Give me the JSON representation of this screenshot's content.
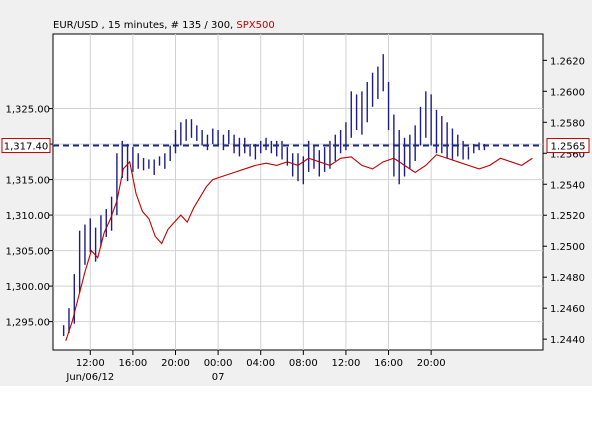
{
  "chart_data": {
    "type": "line",
    "title": {
      "main": "EUR/USD , 15 minutes, # 135 / 300, ",
      "overlay": "SPX500"
    },
    "left_axis": {
      "ylim": [
        1291,
        1335.5
      ],
      "ticks": [
        "1,295.00",
        "1,300.00",
        "1,305.00",
        "1,310.00",
        "1,315.00",
        "1,320.00",
        "1,325.00"
      ],
      "tick_values": [
        1295,
        1300,
        1305,
        1310,
        1315,
        1320,
        1325
      ],
      "current_label": "1,317.40",
      "current_value": 1317.4
    },
    "right_axis": {
      "ylim": [
        1.2433,
        1.2637
      ],
      "ticks": [
        "1.2440",
        "1.2460",
        "1.2480",
        "1.2500",
        "1.2520",
        "1.2540",
        "1.2560",
        "1.2580",
        "1.2600",
        "1.2620"
      ],
      "tick_values": [
        1.244,
        1.246,
        1.248,
        1.25,
        1.252,
        1.254,
        1.256,
        1.258,
        1.26,
        1.262
      ],
      "current_label": "1.2565",
      "current_value": 1.2565
    },
    "x_axis": {
      "xlim": [
        8.5,
        31.5
      ],
      "ticks": [
        "12:00",
        "16:00",
        "20:00",
        "00:00",
        "04:00",
        "08:00",
        "12:00",
        "16:00",
        "20:00"
      ],
      "tick_hours": [
        12,
        16,
        20,
        24,
        28,
        32,
        36,
        40,
        44
      ],
      "date_labels": [
        {
          "text": "Jun/06/12",
          "hour": 12
        },
        {
          "text": "07",
          "hour": 24
        }
      ]
    },
    "grid": true,
    "colors": {
      "bars": "#1c1c8c",
      "overlay_line": "#c00000",
      "current_line": "#1a2b7a",
      "plot_bg": "#ffffff",
      "frame_bg": "#f0f0f0"
    },
    "series": [
      {
        "name": "SPX500",
        "axis": "left",
        "points": [
          [
            9.1,
            1292.3
          ],
          [
            9.4,
            1295.0
          ],
          [
            9.7,
            1298.5
          ],
          [
            10.0,
            1302.0
          ],
          [
            10.3,
            1305.0
          ],
          [
            10.6,
            1304.0
          ],
          [
            10.9,
            1307.5
          ],
          [
            11.2,
            1309.5
          ],
          [
            11.5,
            1312.0
          ],
          [
            11.8,
            1316.5
          ],
          [
            12.1,
            1317.5
          ],
          [
            12.4,
            1313.0
          ],
          [
            12.7,
            1310.5
          ],
          [
            13.0,
            1309.5
          ],
          [
            13.3,
            1307.0
          ],
          [
            13.6,
            1306.0
          ],
          [
            13.9,
            1308.0
          ],
          [
            14.2,
            1309.0
          ],
          [
            14.5,
            1310.0
          ],
          [
            14.8,
            1309.0
          ],
          [
            15.1,
            1311.0
          ],
          [
            15.4,
            1312.5
          ],
          [
            15.7,
            1314.0
          ],
          [
            16.0,
            1315.0
          ],
          [
            16.5,
            1315.5
          ],
          [
            17.0,
            1316.0
          ],
          [
            17.5,
            1316.5
          ],
          [
            18.0,
            1317.0
          ],
          [
            18.5,
            1317.3
          ],
          [
            19.0,
            1317.0
          ],
          [
            19.5,
            1317.5
          ],
          [
            20.0,
            1317.0
          ],
          [
            20.5,
            1318.0
          ],
          [
            21.0,
            1317.5
          ],
          [
            21.5,
            1317.0
          ],
          [
            22.0,
            1318.0
          ],
          [
            22.5,
            1318.2
          ],
          [
            23.0,
            1317.0
          ],
          [
            23.5,
            1316.5
          ],
          [
            24.0,
            1317.5
          ],
          [
            24.5,
            1318.0
          ],
          [
            25.0,
            1317.0
          ],
          [
            25.5,
            1316.0
          ],
          [
            26.0,
            1317.0
          ],
          [
            26.5,
            1318.5
          ],
          [
            27.0,
            1318.0
          ],
          [
            27.5,
            1317.5
          ],
          [
            28.0,
            1317.0
          ],
          [
            28.5,
            1316.5
          ],
          [
            29.0,
            1317.0
          ],
          [
            29.5,
            1318.0
          ],
          [
            30.0,
            1317.5
          ],
          [
            30.5,
            1317.0
          ],
          [
            31.0,
            1318.0
          ]
        ]
      }
    ],
    "eurusd_bars": {
      "axis": "right",
      "bars": [
        [
          9.0,
          1.2442,
          1.2449
        ],
        [
          9.25,
          1.2444,
          1.246
        ],
        [
          9.5,
          1.245,
          1.2482
        ],
        [
          9.75,
          1.247,
          1.251
        ],
        [
          10.0,
          1.2488,
          1.2514
        ],
        [
          10.25,
          1.2496,
          1.2518
        ],
        [
          10.5,
          1.249,
          1.2512
        ],
        [
          10.75,
          1.25,
          1.252
        ],
        [
          11.0,
          1.2506,
          1.2524
        ],
        [
          11.25,
          1.251,
          1.2532
        ],
        [
          11.5,
          1.252,
          1.256
        ],
        [
          11.75,
          1.2544,
          1.2568
        ],
        [
          12.0,
          1.2542,
          1.2566
        ],
        [
          12.25,
          1.2548,
          1.2564
        ],
        [
          12.5,
          1.255,
          1.256
        ],
        [
          12.75,
          1.2549,
          1.2557
        ],
        [
          13.0,
          1.255,
          1.2556
        ],
        [
          13.25,
          1.2546,
          1.2556
        ],
        [
          13.5,
          1.2552,
          1.2558
        ],
        [
          13.75,
          1.255,
          1.256
        ],
        [
          14.0,
          1.2555,
          1.2565
        ],
        [
          14.25,
          1.256,
          1.2575
        ],
        [
          14.5,
          1.2565,
          1.258
        ],
        [
          14.75,
          1.2568,
          1.2582
        ],
        [
          15.0,
          1.257,
          1.2582
        ],
        [
          15.25,
          1.2568,
          1.2578
        ],
        [
          15.5,
          1.2565,
          1.2575
        ],
        [
          15.75,
          1.2562,
          1.2572
        ],
        [
          16.0,
          1.2566,
          1.2576
        ],
        [
          16.25,
          1.2565,
          1.2575
        ],
        [
          16.5,
          1.2562,
          1.2572
        ],
        [
          16.75,
          1.2566,
          1.2575
        ],
        [
          17.0,
          1.256,
          1.2572
        ],
        [
          17.25,
          1.2558,
          1.257
        ],
        [
          17.5,
          1.256,
          1.257
        ],
        [
          17.75,
          1.2558,
          1.2566
        ],
        [
          18.0,
          1.2556,
          1.2566
        ],
        [
          18.25,
          1.256,
          1.2568
        ],
        [
          18.5,
          1.2562,
          1.257
        ],
        [
          18.75,
          1.256,
          1.2568
        ],
        [
          19.0,
          1.2558,
          1.2568
        ],
        [
          19.25,
          1.2556,
          1.2568
        ],
        [
          19.5,
          1.2552,
          1.2564
        ],
        [
          19.75,
          1.2545,
          1.256
        ],
        [
          20.0,
          1.2542,
          1.256
        ],
        [
          20.25,
          1.254,
          1.2558
        ],
        [
          20.5,
          1.2548,
          1.2568
        ],
        [
          20.75,
          1.255,
          1.2565
        ],
        [
          21.0,
          1.2545,
          1.2562
        ],
        [
          21.25,
          1.2548,
          1.2564
        ],
        [
          21.5,
          1.255,
          1.2568
        ],
        [
          21.75,
          1.2555,
          1.2572
        ],
        [
          22.0,
          1.256,
          1.2575
        ],
        [
          22.25,
          1.2562,
          1.258
        ],
        [
          22.5,
          1.257,
          1.26
        ],
        [
          22.75,
          1.2575,
          1.2598
        ],
        [
          23.0,
          1.2572,
          1.26
        ],
        [
          23.25,
          1.258,
          1.2606
        ],
        [
          23.5,
          1.259,
          1.2612
        ],
        [
          23.75,
          1.2595,
          1.2616
        ],
        [
          24.0,
          1.26,
          1.2624
        ],
        [
          24.25,
          1.2575,
          1.2606
        ],
        [
          24.5,
          1.2545,
          1.2585
        ],
        [
          24.75,
          1.254,
          1.2575
        ],
        [
          25.0,
          1.2545,
          1.257
        ],
        [
          25.25,
          1.255,
          1.2572
        ],
        [
          25.5,
          1.2555,
          1.2578
        ],
        [
          25.75,
          1.2565,
          1.259
        ],
        [
          26.0,
          1.257,
          1.26
        ],
        [
          26.25,
          1.2565,
          1.2598
        ],
        [
          26.5,
          1.256,
          1.2588
        ],
        [
          26.75,
          1.256,
          1.2584
        ],
        [
          27.0,
          1.2557,
          1.258
        ],
        [
          27.25,
          1.2556,
          1.2576
        ],
        [
          27.5,
          1.2558,
          1.2572
        ],
        [
          27.75,
          1.2556,
          1.2568
        ],
        [
          28.0,
          1.2556,
          1.2564
        ],
        [
          28.25,
          1.256,
          1.2566
        ],
        [
          28.5,
          1.2562,
          1.2567
        ],
        [
          28.75,
          1.2562,
          1.2566
        ]
      ]
    }
  }
}
